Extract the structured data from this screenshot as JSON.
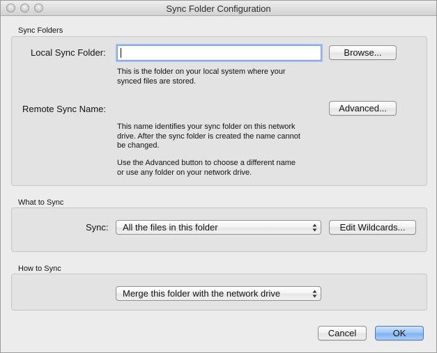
{
  "window": {
    "title": "Sync Folder Configuration"
  },
  "sync_folders": {
    "group_title": "Sync Folders",
    "local_label": "Local Sync Folder:",
    "local_value": "",
    "browse_label": "Browse...",
    "local_help": "This is the folder on your local system where your\nsynced files are stored.",
    "remote_label": "Remote Sync Name:",
    "advanced_label": "Advanced...",
    "remote_help_1": "This name identifies your sync folder on this network\ndrive. After the sync folder is created the name cannot\nbe changed.",
    "remote_help_2": "Use the Advanced button to choose a different name\nor use any folder on your network drive."
  },
  "what_to_sync": {
    "group_title": "What to Sync",
    "sync_label": "Sync:",
    "sync_selected": "All the files in this folder",
    "wildcards_label": "Edit Wildcards..."
  },
  "how_to_sync": {
    "group_title": "How to Sync",
    "method_selected": "Merge this folder with the network drive"
  },
  "footer": {
    "cancel_label": "Cancel",
    "ok_label": "OK"
  }
}
